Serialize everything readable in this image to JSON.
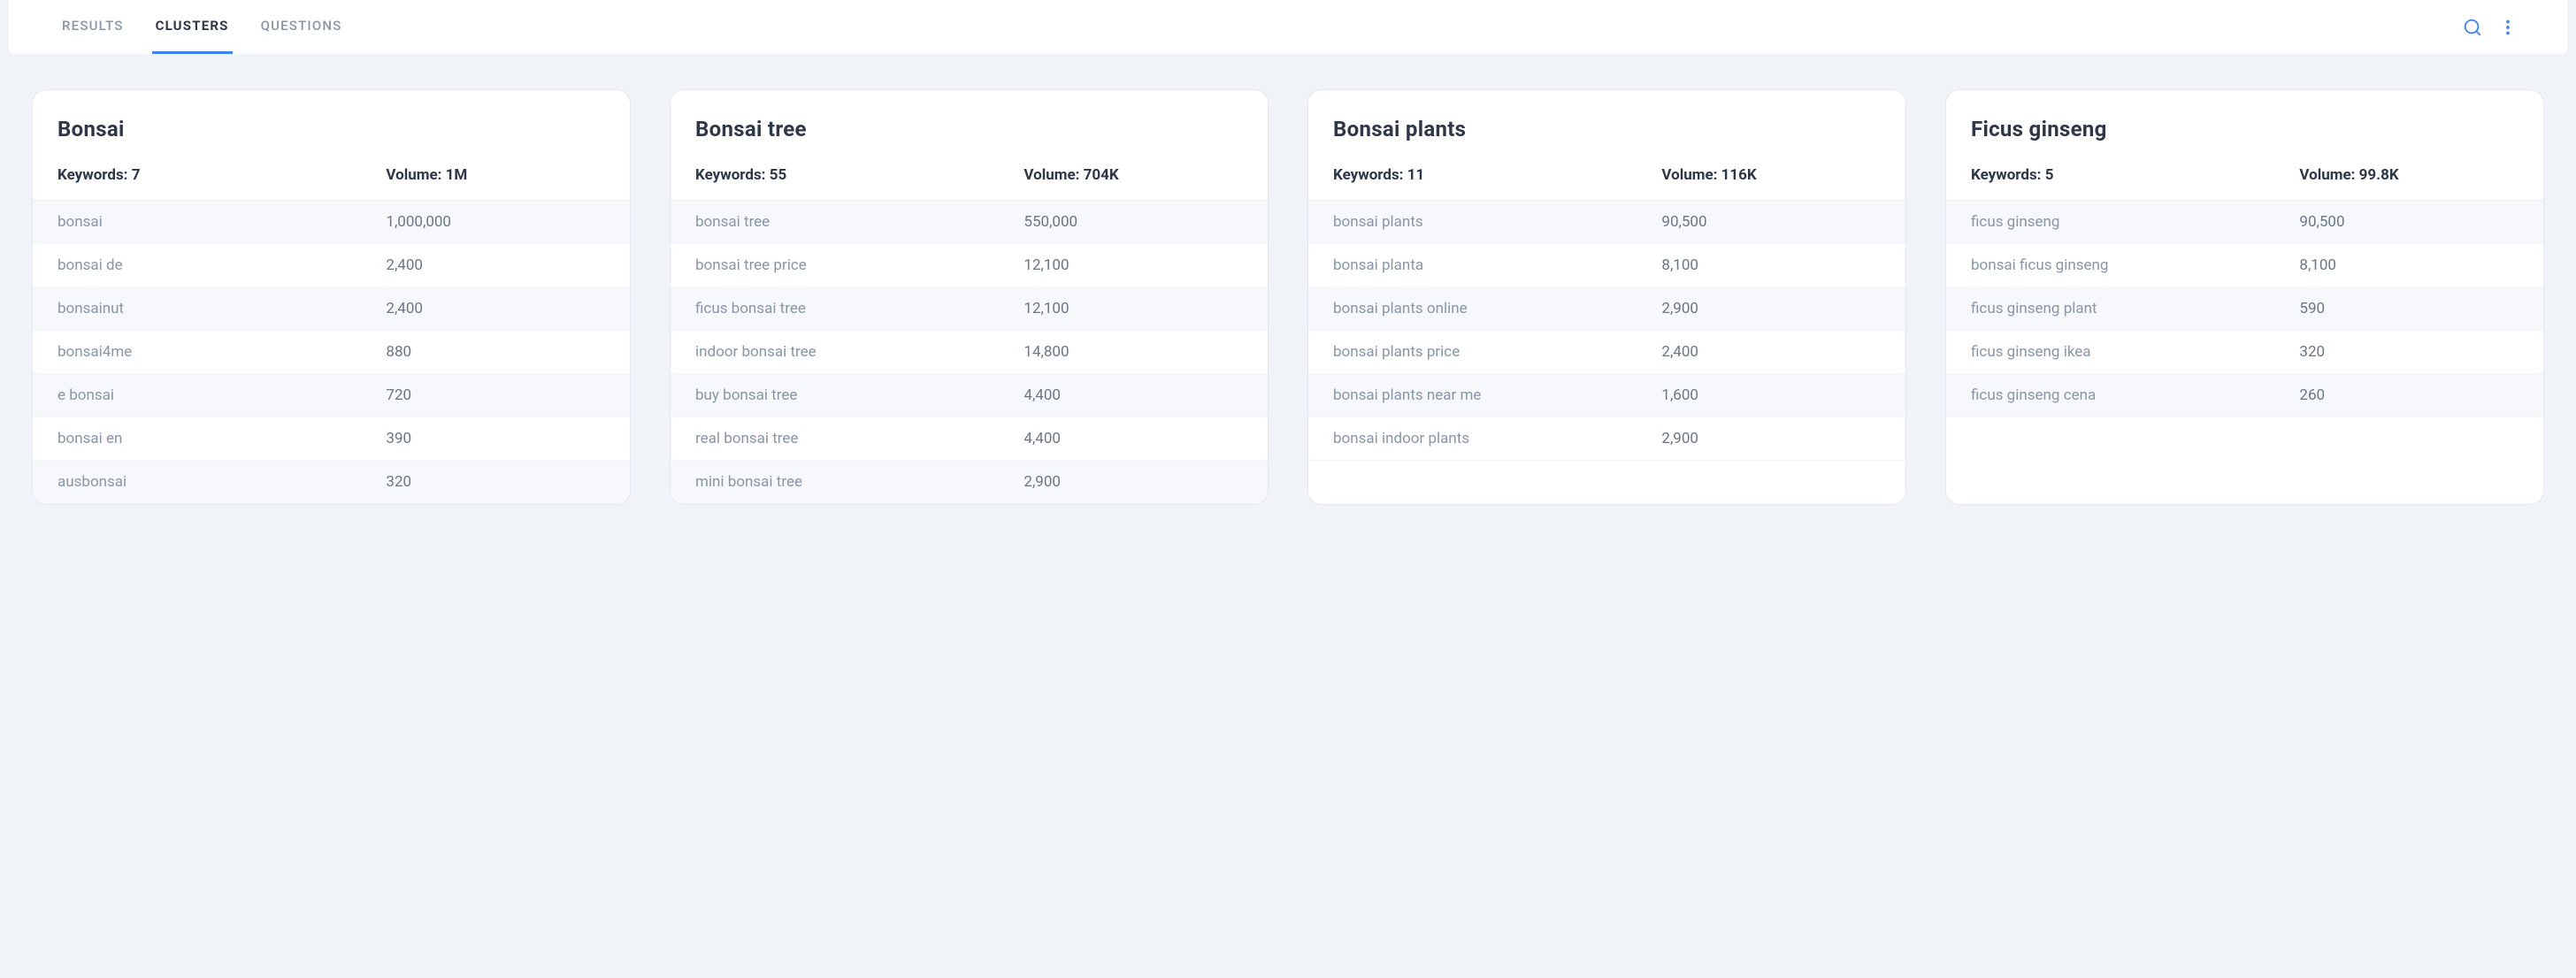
{
  "tabs": {
    "results": "RESULTS",
    "clusters": "CLUSTERS",
    "questions": "QUESTIONS"
  },
  "labels": {
    "keywords_prefix": "Keywords: ",
    "volume_prefix": "Volume: "
  },
  "clusters": [
    {
      "title": "Bonsai",
      "keywords_count": "7",
      "volume": "1M",
      "rows": [
        {
          "keyword": "bonsai",
          "volume": "1,000,000"
        },
        {
          "keyword": "bonsai de",
          "volume": "2,400"
        },
        {
          "keyword": "bonsainut",
          "volume": "2,400"
        },
        {
          "keyword": "bonsai4me",
          "volume": "880"
        },
        {
          "keyword": "e bonsai",
          "volume": "720"
        },
        {
          "keyword": "bonsai en",
          "volume": "390"
        },
        {
          "keyword": "ausbonsai",
          "volume": "320"
        }
      ]
    },
    {
      "title": "Bonsai tree",
      "keywords_count": "55",
      "volume": "704K",
      "rows": [
        {
          "keyword": "bonsai tree",
          "volume": "550,000"
        },
        {
          "keyword": "bonsai tree price",
          "volume": "12,100"
        },
        {
          "keyword": "ficus bonsai tree",
          "volume": "12,100"
        },
        {
          "keyword": "indoor bonsai tree",
          "volume": "14,800"
        },
        {
          "keyword": "buy bonsai tree",
          "volume": "4,400"
        },
        {
          "keyword": "real bonsai tree",
          "volume": "4,400"
        },
        {
          "keyword": "mini bonsai tree",
          "volume": "2,900"
        }
      ]
    },
    {
      "title": "Bonsai plants",
      "keywords_count": "11",
      "volume": "116K",
      "rows": [
        {
          "keyword": "bonsai plants",
          "volume": "90,500"
        },
        {
          "keyword": "bonsai planta",
          "volume": "8,100"
        },
        {
          "keyword": "bonsai plants online",
          "volume": "2,900"
        },
        {
          "keyword": "bonsai plants price",
          "volume": "2,400"
        },
        {
          "keyword": "bonsai plants near me",
          "volume": "1,600"
        },
        {
          "keyword": "bonsai indoor plants",
          "volume": "2,900"
        }
      ]
    },
    {
      "title": "Ficus ginseng",
      "keywords_count": "5",
      "volume": "99.8K",
      "rows": [
        {
          "keyword": "ficus ginseng",
          "volume": "90,500"
        },
        {
          "keyword": "bonsai ficus ginseng",
          "volume": "8,100"
        },
        {
          "keyword": "ficus ginseng plant",
          "volume": "590"
        },
        {
          "keyword": "ficus ginseng ikea",
          "volume": "320"
        },
        {
          "keyword": "ficus ginseng cena",
          "volume": "260"
        }
      ]
    }
  ]
}
